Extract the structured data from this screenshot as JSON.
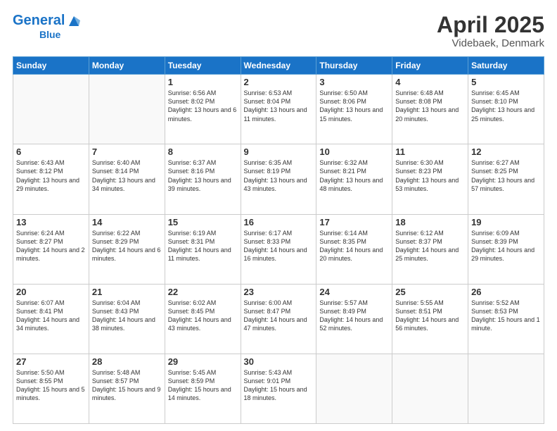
{
  "header": {
    "logo_general": "General",
    "logo_blue": "Blue",
    "title": "April 2025",
    "subtitle": "Videbaek, Denmark"
  },
  "days_of_week": [
    "Sunday",
    "Monday",
    "Tuesday",
    "Wednesday",
    "Thursday",
    "Friday",
    "Saturday"
  ],
  "weeks": [
    [
      {
        "day": "",
        "info": ""
      },
      {
        "day": "",
        "info": ""
      },
      {
        "day": "1",
        "info": "Sunrise: 6:56 AM\nSunset: 8:02 PM\nDaylight: 13 hours and 6 minutes."
      },
      {
        "day": "2",
        "info": "Sunrise: 6:53 AM\nSunset: 8:04 PM\nDaylight: 13 hours and 11 minutes."
      },
      {
        "day": "3",
        "info": "Sunrise: 6:50 AM\nSunset: 8:06 PM\nDaylight: 13 hours and 15 minutes."
      },
      {
        "day": "4",
        "info": "Sunrise: 6:48 AM\nSunset: 8:08 PM\nDaylight: 13 hours and 20 minutes."
      },
      {
        "day": "5",
        "info": "Sunrise: 6:45 AM\nSunset: 8:10 PM\nDaylight: 13 hours and 25 minutes."
      }
    ],
    [
      {
        "day": "6",
        "info": "Sunrise: 6:43 AM\nSunset: 8:12 PM\nDaylight: 13 hours and 29 minutes."
      },
      {
        "day": "7",
        "info": "Sunrise: 6:40 AM\nSunset: 8:14 PM\nDaylight: 13 hours and 34 minutes."
      },
      {
        "day": "8",
        "info": "Sunrise: 6:37 AM\nSunset: 8:16 PM\nDaylight: 13 hours and 39 minutes."
      },
      {
        "day": "9",
        "info": "Sunrise: 6:35 AM\nSunset: 8:19 PM\nDaylight: 13 hours and 43 minutes."
      },
      {
        "day": "10",
        "info": "Sunrise: 6:32 AM\nSunset: 8:21 PM\nDaylight: 13 hours and 48 minutes."
      },
      {
        "day": "11",
        "info": "Sunrise: 6:30 AM\nSunset: 8:23 PM\nDaylight: 13 hours and 53 minutes."
      },
      {
        "day": "12",
        "info": "Sunrise: 6:27 AM\nSunset: 8:25 PM\nDaylight: 13 hours and 57 minutes."
      }
    ],
    [
      {
        "day": "13",
        "info": "Sunrise: 6:24 AM\nSunset: 8:27 PM\nDaylight: 14 hours and 2 minutes."
      },
      {
        "day": "14",
        "info": "Sunrise: 6:22 AM\nSunset: 8:29 PM\nDaylight: 14 hours and 6 minutes."
      },
      {
        "day": "15",
        "info": "Sunrise: 6:19 AM\nSunset: 8:31 PM\nDaylight: 14 hours and 11 minutes."
      },
      {
        "day": "16",
        "info": "Sunrise: 6:17 AM\nSunset: 8:33 PM\nDaylight: 14 hours and 16 minutes."
      },
      {
        "day": "17",
        "info": "Sunrise: 6:14 AM\nSunset: 8:35 PM\nDaylight: 14 hours and 20 minutes."
      },
      {
        "day": "18",
        "info": "Sunrise: 6:12 AM\nSunset: 8:37 PM\nDaylight: 14 hours and 25 minutes."
      },
      {
        "day": "19",
        "info": "Sunrise: 6:09 AM\nSunset: 8:39 PM\nDaylight: 14 hours and 29 minutes."
      }
    ],
    [
      {
        "day": "20",
        "info": "Sunrise: 6:07 AM\nSunset: 8:41 PM\nDaylight: 14 hours and 34 minutes."
      },
      {
        "day": "21",
        "info": "Sunrise: 6:04 AM\nSunset: 8:43 PM\nDaylight: 14 hours and 38 minutes."
      },
      {
        "day": "22",
        "info": "Sunrise: 6:02 AM\nSunset: 8:45 PM\nDaylight: 14 hours and 43 minutes."
      },
      {
        "day": "23",
        "info": "Sunrise: 6:00 AM\nSunset: 8:47 PM\nDaylight: 14 hours and 47 minutes."
      },
      {
        "day": "24",
        "info": "Sunrise: 5:57 AM\nSunset: 8:49 PM\nDaylight: 14 hours and 52 minutes."
      },
      {
        "day": "25",
        "info": "Sunrise: 5:55 AM\nSunset: 8:51 PM\nDaylight: 14 hours and 56 minutes."
      },
      {
        "day": "26",
        "info": "Sunrise: 5:52 AM\nSunset: 8:53 PM\nDaylight: 15 hours and 1 minute."
      }
    ],
    [
      {
        "day": "27",
        "info": "Sunrise: 5:50 AM\nSunset: 8:55 PM\nDaylight: 15 hours and 5 minutes."
      },
      {
        "day": "28",
        "info": "Sunrise: 5:48 AM\nSunset: 8:57 PM\nDaylight: 15 hours and 9 minutes."
      },
      {
        "day": "29",
        "info": "Sunrise: 5:45 AM\nSunset: 8:59 PM\nDaylight: 15 hours and 14 minutes."
      },
      {
        "day": "30",
        "info": "Sunrise: 5:43 AM\nSunset: 9:01 PM\nDaylight: 15 hours and 18 minutes."
      },
      {
        "day": "",
        "info": ""
      },
      {
        "day": "",
        "info": ""
      },
      {
        "day": "",
        "info": ""
      }
    ]
  ]
}
